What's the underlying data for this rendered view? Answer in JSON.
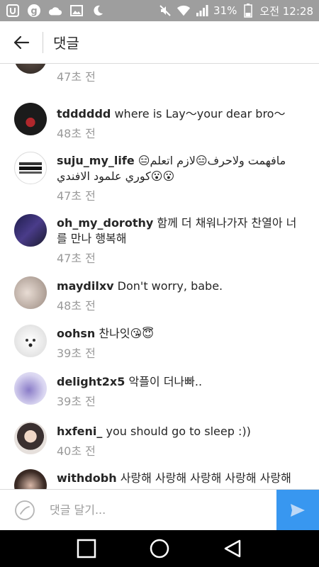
{
  "status_bar": {
    "battery_percent": "31%",
    "clock": "오전 12:28"
  },
  "header": {
    "title": "댓글"
  },
  "comments": [
    {
      "username": "",
      "text": "😔😔😔😔",
      "time": "47초 전"
    },
    {
      "username": "tdddddd",
      "text": "where is Lay〜your dear bro〜",
      "time": "48초 전"
    },
    {
      "username": "suju_my_life",
      "text": "مافهمت ولاحرف😑لازم اتعلم😑 كوري علمود الافندي😮😮",
      "time": "47초 전"
    },
    {
      "username": "oh_my_dorothy",
      "text": "함께 더 채워나가자 찬열아 너를 만나 행복해",
      "time": "47초 전"
    },
    {
      "username": "maydilxv",
      "text": "Don't worry, babe.",
      "time": "48초 전"
    },
    {
      "username": "oohsn",
      "text": "찬나잇😘😇",
      "time": "39초 전"
    },
    {
      "username": "delight2x5",
      "text": "악플이 더나빠..",
      "time": "39초 전"
    },
    {
      "username": "hxfeni_",
      "text": "you should go to sleep :))",
      "time": "40초 전"
    },
    {
      "username": "withdobh",
      "text": "사랑해 사랑해 사랑해 사랑해 사랑해",
      "time": ""
    }
  ],
  "input": {
    "placeholder": "댓글 달기..."
  },
  "colors": {
    "status_bar_bg": "#9e9e9e",
    "send_button_bg": "#3897f0",
    "timestamp": "#999999"
  }
}
